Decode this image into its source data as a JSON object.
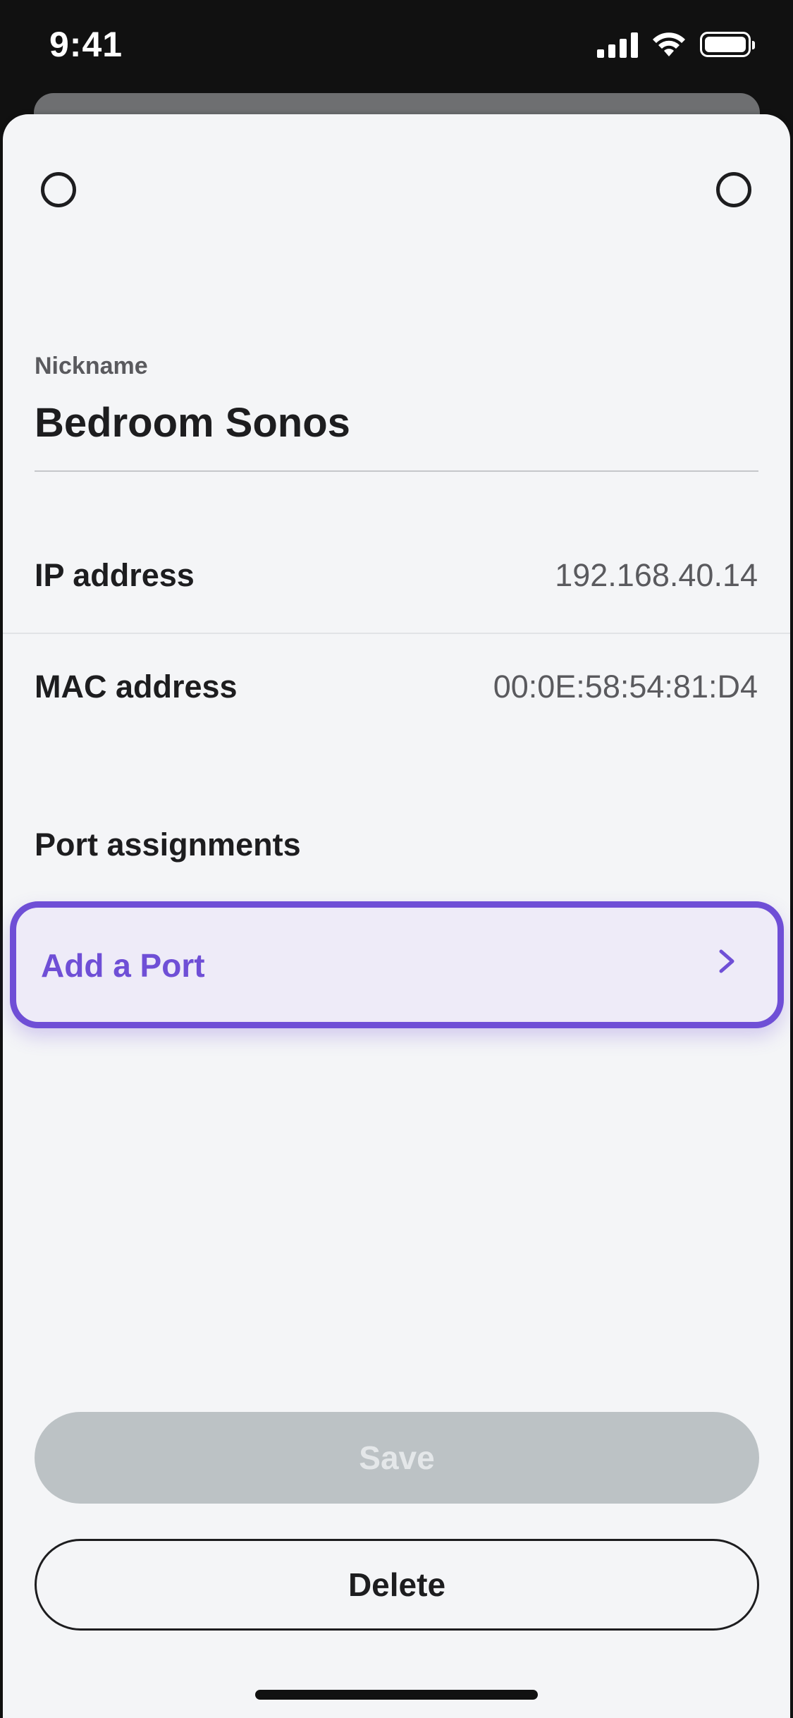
{
  "status_bar": {
    "time": "9:41"
  },
  "form": {
    "nickname_label": "Nickname",
    "nickname_value": "Bedroom Sonos"
  },
  "details": [
    {
      "label": "IP address",
      "value": "192.168.40.14"
    },
    {
      "label": "MAC address",
      "value": "00:0E:58:54:81:D4"
    }
  ],
  "ports": {
    "section_title": "Port assignments",
    "add_label": "Add a Port"
  },
  "actions": {
    "save_label": "Save",
    "delete_label": "Delete"
  },
  "colors": {
    "accent": "#6f4fd6",
    "accent_bg": "#eeebf8",
    "save_disabled_bg": "#bcc2c5",
    "sheet_bg": "#f4f5f7"
  }
}
